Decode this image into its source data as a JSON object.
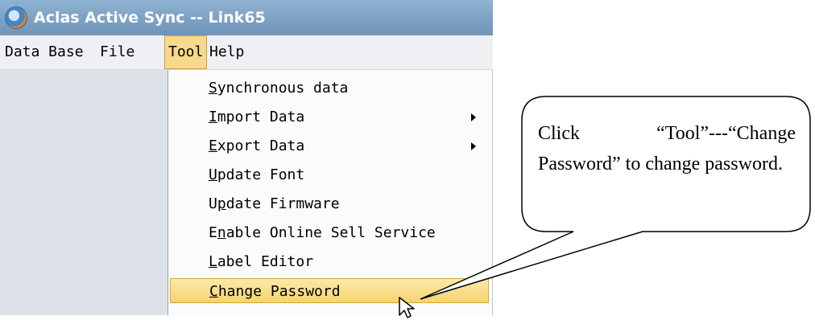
{
  "window": {
    "title": "Aclas Active Sync -- Link65",
    "icon": "app-sync-icon"
  },
  "menubar": {
    "items": [
      "Data Base",
      "File",
      "Tool",
      "Help"
    ],
    "active": "Tool"
  },
  "dropdown": {
    "items": [
      {
        "pre": "",
        "ul": "S",
        "post": "ynchronous data",
        "submenu": false,
        "highlight": false
      },
      {
        "pre": "",
        "ul": "I",
        "post": "mport Data",
        "submenu": true,
        "highlight": false
      },
      {
        "pre": "",
        "ul": "E",
        "post": "xport Data",
        "submenu": true,
        "highlight": false
      },
      {
        "pre": "",
        "ul": "U",
        "post": "pdate Font",
        "submenu": false,
        "highlight": false
      },
      {
        "pre": "U",
        "ul": "p",
        "post": "date Firmware",
        "submenu": false,
        "highlight": false
      },
      {
        "pre": "E",
        "ul": "n",
        "post": "able Online Sell Service",
        "submenu": false,
        "highlight": false
      },
      {
        "pre": "",
        "ul": "L",
        "post": "abel Editor",
        "submenu": false,
        "highlight": false
      },
      {
        "pre": "",
        "ul": "C",
        "post": "hange Password",
        "submenu": false,
        "highlight": true
      }
    ]
  },
  "callout": {
    "text": "Click “Tool”---“Change Password” to change password."
  },
  "colors": {
    "titlebar": "#7fa3c6",
    "menu_highlight": "#f6d98a",
    "client": "#dde2e8"
  }
}
